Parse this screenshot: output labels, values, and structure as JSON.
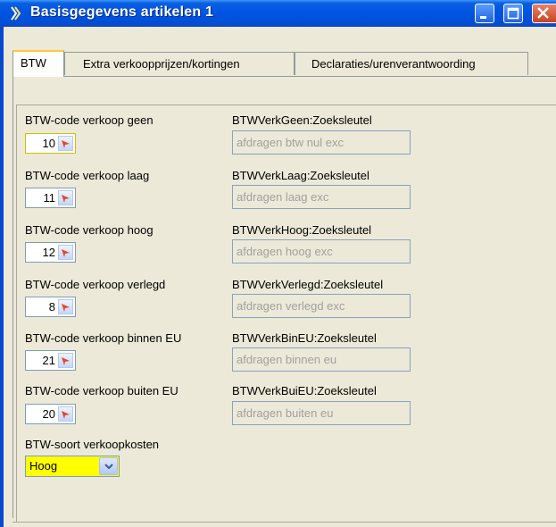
{
  "window": {
    "title": "Basisgegevens artikelen 1",
    "app_icon": "app-logo-icon"
  },
  "tabs": [
    {
      "label": "BTW",
      "active": true
    },
    {
      "label": "Extra verkoopprijzen/kortingen",
      "active": false
    },
    {
      "label": "Declaraties/urenverantwoording",
      "active": false
    }
  ],
  "fields": [
    {
      "label": "BTW-code verkoop geen",
      "code": "10",
      "lookup_label": "BTWVerkGeen:Zoeksleutel",
      "lookup_value": "afdragen btw nul exc"
    },
    {
      "label": "BTW-code verkoop laag",
      "code": "11",
      "lookup_label": "BTWVerkLaag:Zoeksleutel",
      "lookup_value": "afdragen laag exc"
    },
    {
      "label": "BTW-code verkoop hoog",
      "code": "12",
      "lookup_label": "BTWVerkHoog:Zoeksleutel",
      "lookup_value": "afdragen hoog exc"
    },
    {
      "label": "BTW-code verkoop verlegd",
      "code": "8",
      "lookup_label": "BTWVerkVerlegd:Zoeksleutel",
      "lookup_value": "afdragen verlegd exc"
    },
    {
      "label": "BTW-code verkoop binnen EU",
      "code": "21",
      "lookup_label": "BTWVerkBinEU:Zoeksleutel",
      "lookup_value": "afdragen binnen eu"
    },
    {
      "label": "BTW-code verkoop buiten EU",
      "code": "20",
      "lookup_label": "BTWVerkBuiEU:Zoeksleutel",
      "lookup_value": "afdragen buiten eu"
    }
  ],
  "soort": {
    "label": "BTW-soort verkoopkosten",
    "value": "Hoog"
  },
  "colors": {
    "title_bar": "#0054e3",
    "combo_bg": "#ffff00",
    "active_tab_accent": "#ffc83c"
  }
}
